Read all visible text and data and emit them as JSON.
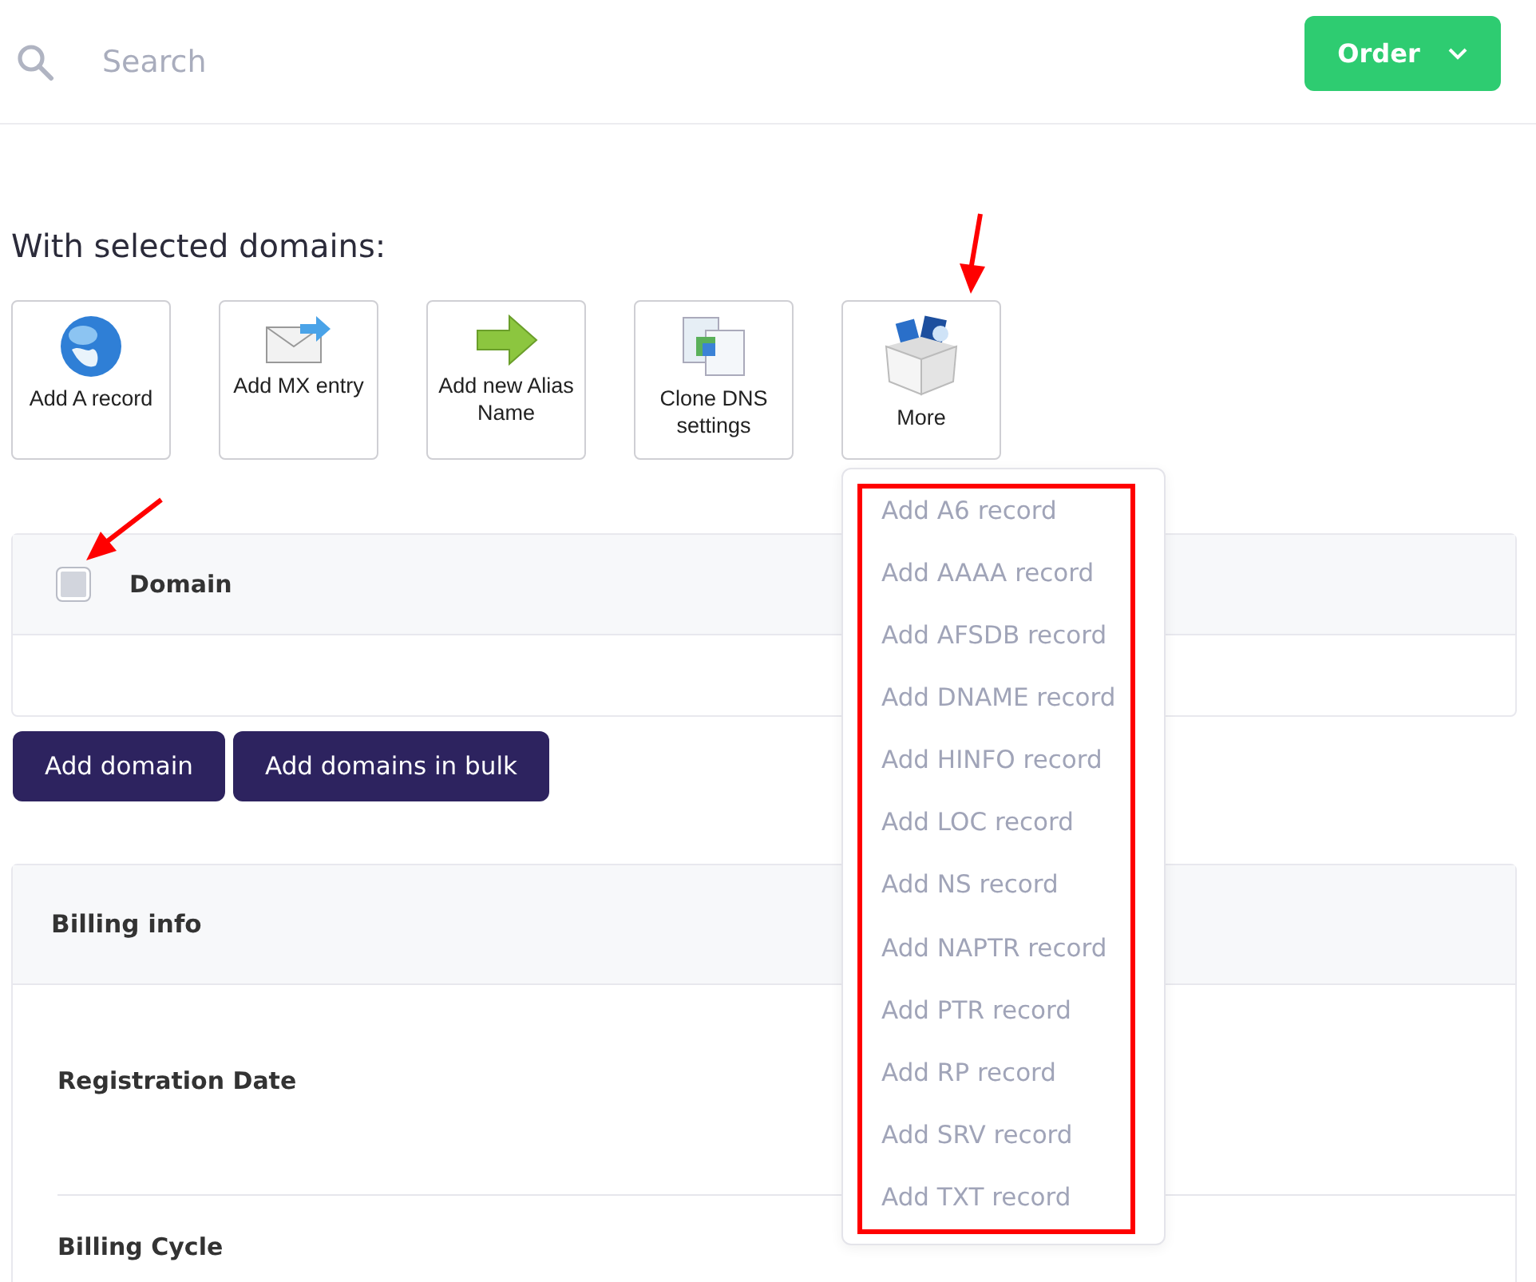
{
  "search": {
    "placeholder": "Search"
  },
  "order_button": {
    "label": "Order"
  },
  "bulk_actions": {
    "title": "With selected domains:",
    "actions": [
      {
        "label": "Add A record",
        "kind": "globe"
      },
      {
        "label": "Add MX entry",
        "kind": "envelope"
      },
      {
        "label": "Add new Alias Name",
        "kind": "arrow"
      },
      {
        "label": "Clone DNS settings",
        "kind": "documents"
      },
      {
        "label": "More",
        "kind": "box"
      }
    ]
  },
  "more_menu": {
    "expanded": true,
    "items": [
      "Add A6 record",
      "Add AAAA record",
      "Add AFSDB record",
      "Add DNAME record",
      "Add HINFO record",
      "Add LOC record",
      "Add NS record",
      "Add NAPTR record",
      "Add PTR record",
      "Add RP record",
      "Add SRV record",
      "Add TXT record"
    ]
  },
  "domain_table": {
    "select_all": {
      "checked": false
    },
    "columns": [
      "Domain"
    ]
  },
  "buttons": [
    "Add domain",
    "Add domains in bulk"
  ],
  "billing": {
    "title": "Billing info",
    "fields": [
      "Registration Date",
      "Billing Cycle"
    ]
  }
}
